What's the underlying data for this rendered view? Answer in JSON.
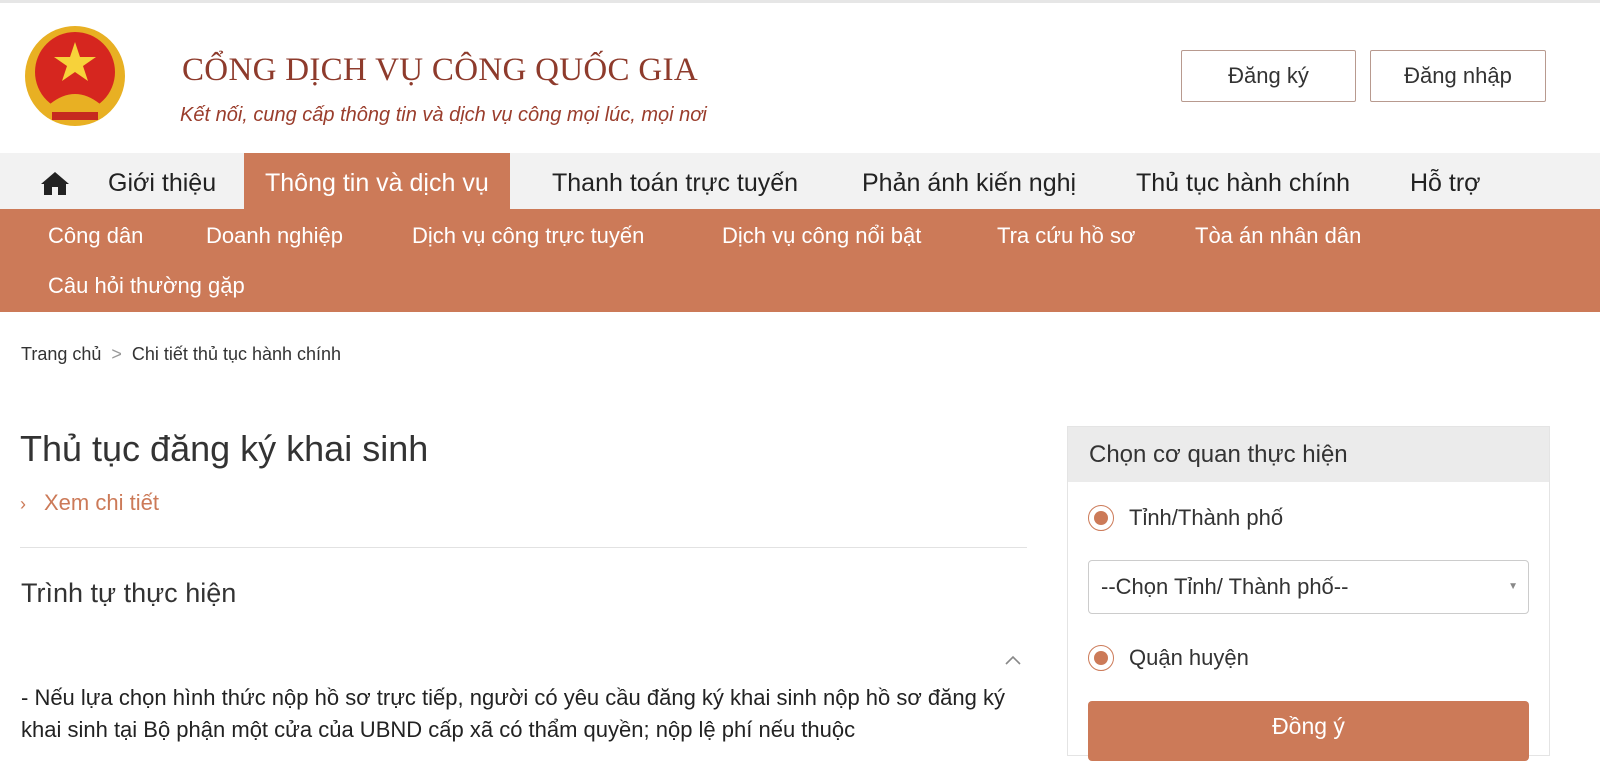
{
  "header": {
    "logo_title": "CỔNG DỊCH VỤ CÔNG QUỐC GIA",
    "logo_sub": "Kết nối, cung cấp thông tin và dịch vụ công mọi lúc, mọi nơi",
    "register": "Đăng ký",
    "login": "Đăng nhập"
  },
  "nav": {
    "items": [
      "Giới thiệu",
      "Thông tin và dịch vụ",
      "Thanh toán trực tuyến",
      "Phản ánh kiến nghị",
      "Thủ tục hành chính",
      "Hỗ trợ"
    ]
  },
  "subnav": {
    "items": [
      "Công dân",
      "Doanh nghiệp",
      "Dịch vụ công trực tuyến",
      "Dịch vụ công nổi bật",
      "Tra cứu hồ sơ",
      "Tòa án nhân dân",
      "Câu hỏi thường gặp"
    ]
  },
  "breadcrumb": {
    "home": "Trang chủ",
    "sep": ">",
    "current": "Chi tiết thủ tục hành chính"
  },
  "main": {
    "title": "Thủ tục đăng ký khai sinh",
    "more": "Xem chi tiết",
    "more_icon": "›",
    "section": "Trình tự thực hiện",
    "paragraph": "- Nếu lựa chọn hình thức nộp hồ sơ trực tiếp, người có yêu cầu đăng ký khai sinh nộp hồ sơ đăng ký khai sinh tại Bộ phận một cửa của UBND cấp xã có thẩm quyền; nộp lệ phí nếu thuộc"
  },
  "sidebar": {
    "title": "Chọn cơ quan thực hiện",
    "radio1": "Tỉnh/Thành phố",
    "select": "--Chọn Tỉnh/ Thành phố--",
    "radio2": "Quận huyện",
    "submit": "Đồng ý"
  },
  "colors": {
    "accent": "#cc7a58",
    "brand": "#9a3d2c"
  }
}
